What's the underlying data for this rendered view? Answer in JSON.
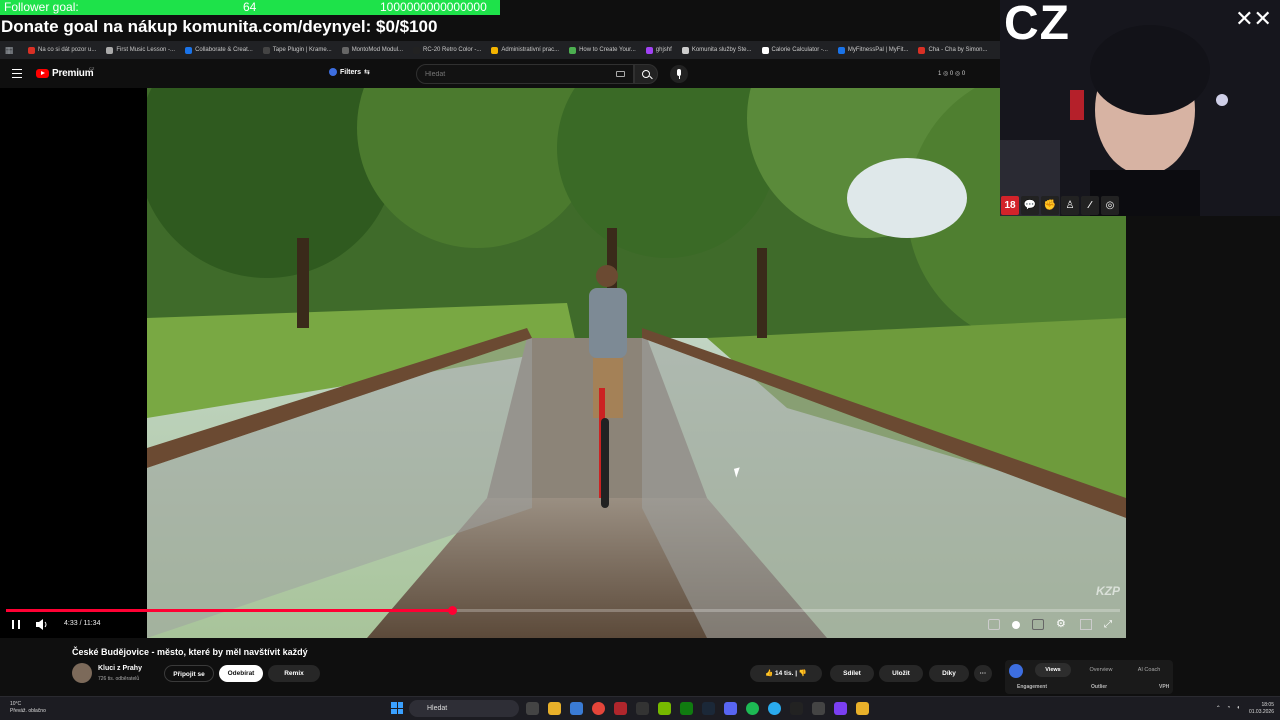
{
  "overlay": {
    "follower_label": "Follower goal:",
    "follower_count": "64",
    "follower_target": "1000000000000000",
    "donate_text": "Donate goal na nákup komunita.com/deynyel: $0/$100",
    "webcam_text": "CZ",
    "badge_age": "18",
    "colors": {
      "goal_bar": "#1ee24a"
    }
  },
  "bookmarks": [
    {
      "label": "Na co si dát pozor u...",
      "color": "#d93025"
    },
    {
      "label": "First Music Lesson -...",
      "color": "#aaaaaa"
    },
    {
      "label": "Collaborate & Creat...",
      "color": "#1a73e8"
    },
    {
      "label": "Tape Plugin | Krame...",
      "color": "#444444"
    },
    {
      "label": "MontoMod Modul...",
      "color": "#666666"
    },
    {
      "label": "RC-20 Retro Color -...",
      "color": "#222222"
    },
    {
      "label": "Administrativní prac...",
      "color": "#f4b400"
    },
    {
      "label": "How to Create Your...",
      "color": "#4caf50"
    },
    {
      "label": "ghjshf",
      "color": "#a142f4"
    },
    {
      "label": "Komunita služby Ste...",
      "color": "#cccccc"
    },
    {
      "label": "Calorie Calculator -...",
      "color": "#ffffff"
    },
    {
      "label": "MyFitnessPal | MyFit...",
      "color": "#1a73e8"
    },
    {
      "label": "Cha - Cha by Simon...",
      "color": "#d93025"
    }
  ],
  "header": {
    "brand": "Premium",
    "region": "CZ",
    "filters_label": "Filters",
    "search_placeholder": "Hledat",
    "stats": "1 ◎ 0 ◎ 0"
  },
  "player": {
    "current_time": "4:33",
    "duration": "11:34",
    "time_display": "4:33 / 11:34",
    "progress_fraction": 0.4,
    "watermark": "KZP"
  },
  "video_info": {
    "title": "České Budějovice - město, které by měl navštívit každý",
    "channel_name": "Kluci z Prahy",
    "subscribers": "726 tis. odběratelů",
    "join_label": "Připojit se",
    "subscribe_label": "Odebírat",
    "remix_label": "Remix",
    "likes": "14 tis.",
    "share_label": "Sdílet",
    "save_label": "Uložit",
    "thanks_label": "Díky",
    "more_label": "···"
  },
  "side_panel": {
    "tabs": [
      "Views",
      "Overview",
      "AI Coach"
    ],
    "labels": [
      "Engagement",
      "Outlier",
      "VPH"
    ]
  },
  "taskbar": {
    "weather_temp": "10°C",
    "weather_desc": "Převáž. oblačno",
    "search_label": "Hledat",
    "time": "18:05",
    "date": "01.03.2026"
  }
}
